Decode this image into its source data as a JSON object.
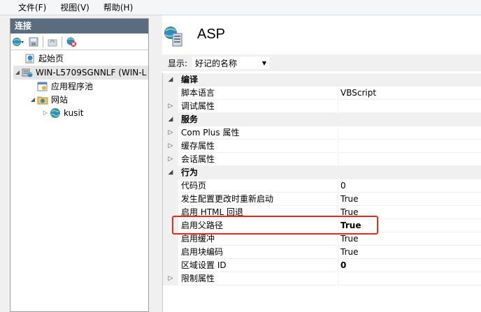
{
  "menu": [
    "文件(F)",
    "视图(V)",
    "帮助(H)"
  ],
  "connections": {
    "title": "连接",
    "tree": [
      {
        "label": "起始页",
        "icon": "start-page-icon",
        "expander": ""
      },
      {
        "label": "WIN-L5709SGNNLF (WIN-L",
        "icon": "server-icon",
        "expander": "◢"
      },
      {
        "label": "应用程序池",
        "icon": "app-pool-icon",
        "expander": ""
      },
      {
        "label": "网站",
        "icon": "sites-folder-icon",
        "expander": "◢"
      },
      {
        "label": "kusit",
        "icon": "globe-icon",
        "expander": "▷"
      }
    ]
  },
  "feature": {
    "title": "ASP",
    "show_label": "显示:",
    "show_value": "好记的名称"
  },
  "properties": [
    {
      "type": "cat",
      "label": "编译",
      "gutter": "◢"
    },
    {
      "type": "prop",
      "label": "脚本语言",
      "value": "VBScript",
      "gutter": "",
      "bold": false
    },
    {
      "type": "prop",
      "label": "调试属性",
      "value": "",
      "gutter": "▷",
      "bold": false
    },
    {
      "type": "cat",
      "label": "服务",
      "gutter": "◢"
    },
    {
      "type": "prop",
      "label": "Com Plus 属性",
      "value": "",
      "gutter": "▷",
      "bold": false
    },
    {
      "type": "prop",
      "label": "缓存属性",
      "value": "",
      "gutter": "▷",
      "bold": false
    },
    {
      "type": "prop",
      "label": "会话属性",
      "value": "",
      "gutter": "▷",
      "bold": false
    },
    {
      "type": "cat",
      "label": "行为",
      "gutter": "◢"
    },
    {
      "type": "prop",
      "label": "代码页",
      "value": "0",
      "gutter": "",
      "bold": false
    },
    {
      "type": "prop",
      "label": "发生配置更改时重新启动",
      "value": "True",
      "gutter": "",
      "bold": false
    },
    {
      "type": "prop",
      "label": "启用 HTML 回退",
      "value": "True",
      "gutter": "",
      "bold": false
    },
    {
      "type": "prop",
      "label": "启用父路径",
      "value": "True",
      "gutter": "",
      "bold": true
    },
    {
      "type": "prop",
      "label": "启用缓冲",
      "value": "True",
      "gutter": "",
      "bold": false
    },
    {
      "type": "prop",
      "label": "启用块编码",
      "value": "True",
      "gutter": "",
      "bold": false
    },
    {
      "type": "prop",
      "label": "区域设置 ID",
      "value": "0",
      "gutter": "",
      "bold": true
    },
    {
      "type": "prop",
      "label": "限制属性",
      "value": "",
      "gutter": "▷",
      "bold": false
    }
  ],
  "colors": {
    "highlight": "#e8291c",
    "pane_header": "#5a6d7e"
  }
}
